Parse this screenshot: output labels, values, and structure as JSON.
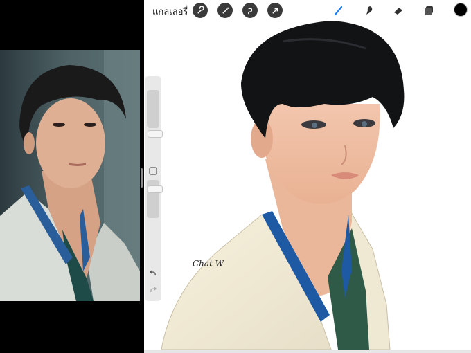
{
  "topbar": {
    "gallery_label": "แกลเลอรี่",
    "tools": [
      "wrench-icon",
      "magic-wand-icon",
      "selection-icon",
      "transform-arrow-icon"
    ],
    "right_tools": [
      "brush-icon",
      "smudge-icon",
      "eraser-icon",
      "layers-icon"
    ],
    "active_tool": "brush-icon",
    "current_color": "#000000"
  },
  "colors": {
    "accent": "#1e7cf2",
    "canvas": "#ffffff",
    "sidebar": "#e8e8e8"
  },
  "canvas": {
    "signature_text": "Chat W"
  }
}
